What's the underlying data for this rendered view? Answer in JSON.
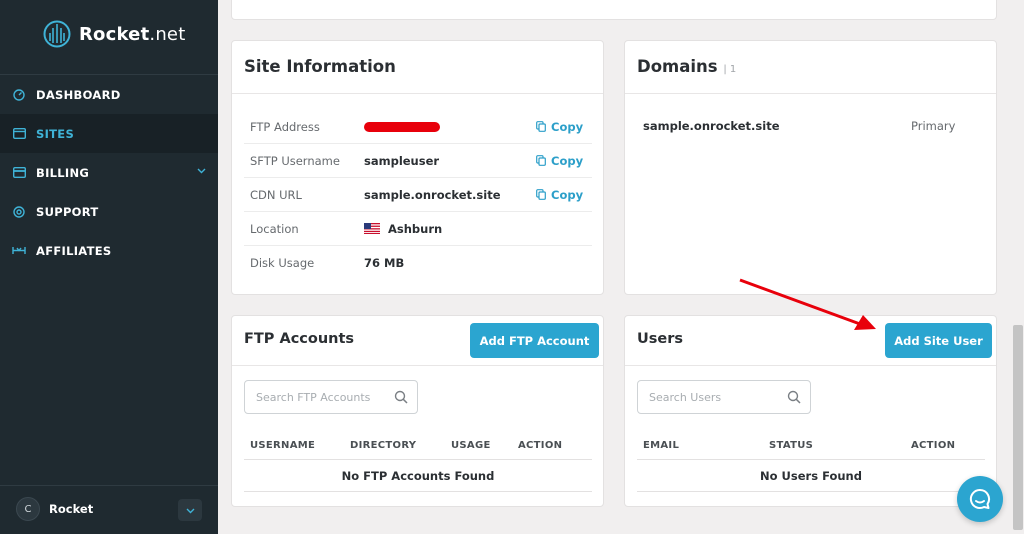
{
  "brand": {
    "name_main": "Rocket",
    "name_suffix": ".net"
  },
  "sidebar": {
    "items": [
      {
        "label": "DASHBOARD",
        "icon": "dashboard-icon"
      },
      {
        "label": "SITES",
        "icon": "sites-icon",
        "active": true
      },
      {
        "label": "BILLING",
        "icon": "billing-icon",
        "has_submenu": true
      },
      {
        "label": "SUPPORT",
        "icon": "support-icon"
      },
      {
        "label": "AFFILIATES",
        "icon": "affiliates-icon"
      }
    ],
    "user": {
      "initial": "C",
      "name": "Rocket"
    }
  },
  "site_info": {
    "title": "Site Information",
    "rows": [
      {
        "label": "FTP Address",
        "value": "",
        "redacted": true,
        "copy": "Copy"
      },
      {
        "label": "SFTP Username",
        "value": "sampleuser",
        "copy": "Copy"
      },
      {
        "label": "CDN URL",
        "value": "sample.onrocket.site",
        "copy": "Copy"
      },
      {
        "label": "Location",
        "value": "Ashburn",
        "flag": "us-flag-icon"
      },
      {
        "label": "Disk Usage",
        "value": "76 MB"
      }
    ]
  },
  "domains": {
    "title": "Domains",
    "count": "| 1",
    "items": [
      {
        "name": "sample.onrocket.site",
        "type": "Primary"
      }
    ]
  },
  "ftp_accounts": {
    "title": "FTP Accounts",
    "add_label": "Add FTP Account",
    "search_placeholder": "Search FTP Accounts",
    "columns": [
      "USERNAME",
      "DIRECTORY",
      "USAGE",
      "ACTION"
    ],
    "empty": "No FTP Accounts Found"
  },
  "users": {
    "title": "Users",
    "add_label": "Add Site User",
    "search_placeholder": "Search Users",
    "columns": [
      "EMAIL",
      "STATUS",
      "ACTION"
    ],
    "empty": "No Users Found"
  },
  "colors": {
    "accent": "#2ba5d0",
    "sidebar_bg": "#1f2a30",
    "annotation_arrow": "#e8000b"
  }
}
